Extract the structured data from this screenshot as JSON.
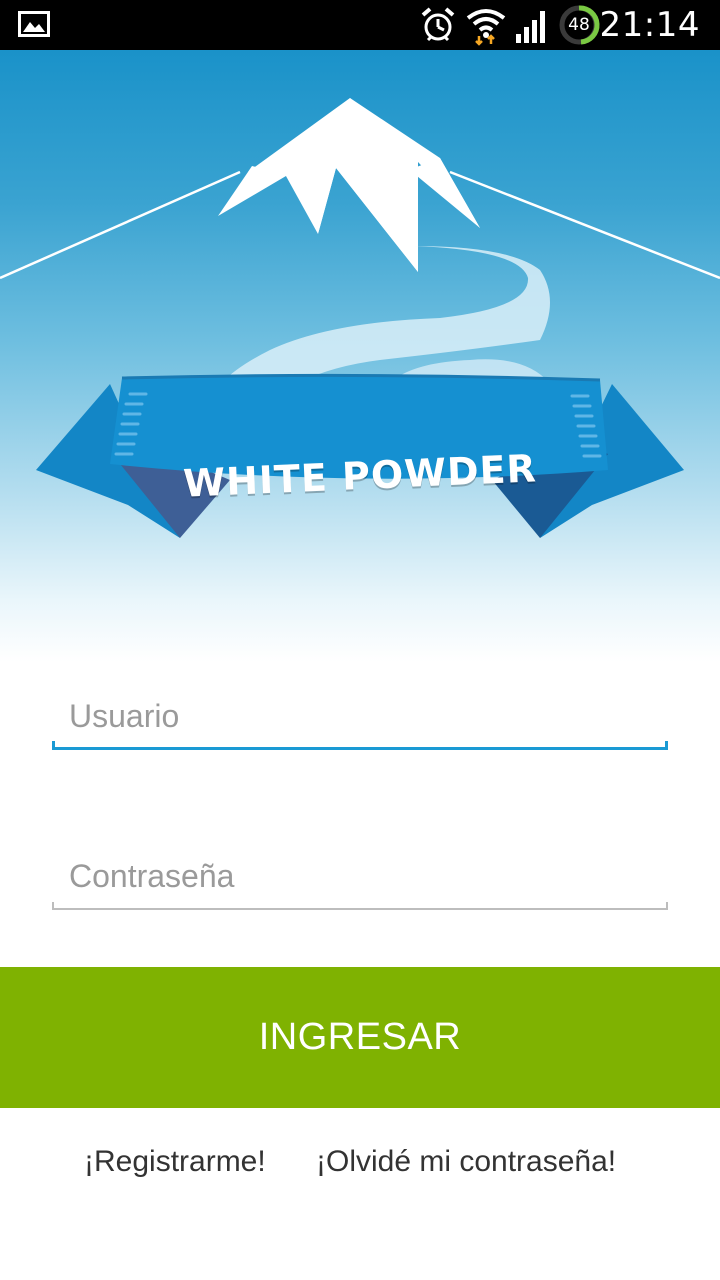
{
  "status_bar": {
    "time": "21:14",
    "battery_level": "48",
    "icons": [
      "gallery-icon",
      "alarm-icon",
      "wifi-icon",
      "signal-icon",
      "battery-icon"
    ]
  },
  "hero": {
    "brand_title": "WHITE POWDER",
    "colors": {
      "sky_top": "#1a92c9",
      "ribbon": "#1386c6",
      "ribbon_dark": "#1a5a94"
    }
  },
  "form": {
    "username": {
      "placeholder": "Usuario",
      "value": ""
    },
    "password": {
      "placeholder": "Contraseña",
      "value": ""
    },
    "accent_color": "#1a9ad4"
  },
  "login_button": {
    "label": "INGRESAR",
    "color": "#7fb201"
  },
  "links": {
    "register": "¡Registrarme!",
    "forgot_password": "¡Olvidé mi contraseña!"
  }
}
